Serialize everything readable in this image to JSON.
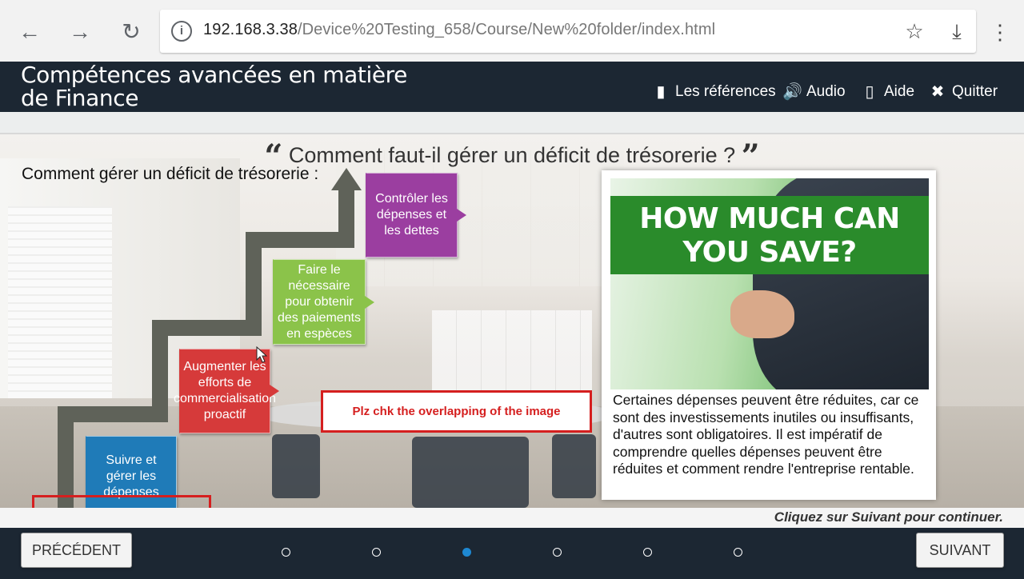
{
  "browser": {
    "url_host": "192.168.3.38",
    "url_path": "/Device%20Testing_658/Course/New%20folder/index.html"
  },
  "header": {
    "title": "Compétences avancées en matière de Finance",
    "links": [
      {
        "label": "Les références",
        "icon": "bookmark-icon"
      },
      {
        "label": "Audio",
        "icon": "speaker-icon"
      },
      {
        "label": "Aide",
        "icon": "book-icon"
      },
      {
        "label": "Quitter",
        "icon": "close-icon"
      }
    ]
  },
  "content": {
    "question": "Comment faut-il gérer un déficit de trésorerie ?",
    "subheading": "Comment gérer un déficit de trésorerie :",
    "steps": [
      "Suivre et gérer les dépenses",
      "Augmenter les efforts de commercialisation proactif",
      "Faire le nécessaire pour obtenir des paiements en espèces",
      "Contrôler les dépenses et les dettes"
    ],
    "promo_text": "HOW MUCH CAN YOU SAVE?",
    "card_text": "Certaines dépenses peuvent être réduites, car ce sont des investissements inutiles ou insuffisants, d'autres sont obligatoires. Il est impératif de comprendre quelles dépenses peuvent être réduites et comment rendre l'entreprise rentable.",
    "annotation": "Plz chk the overlapping of the image",
    "continue_hint": "Cliquez sur Suivant pour continuer."
  },
  "footer": {
    "prev_label": "PRÉCÉDENT",
    "next_label": "SUIVANT",
    "page_count": 6,
    "active_page": 3
  },
  "colors": {
    "header_bg": "#1c2733",
    "step_blue": "#1f7bb8",
    "step_red": "#d63a3a",
    "step_green": "#8bc34a",
    "step_purple": "#9b3ea0",
    "annotation_red": "#d51f1f",
    "active_dot": "#1e88d2"
  }
}
